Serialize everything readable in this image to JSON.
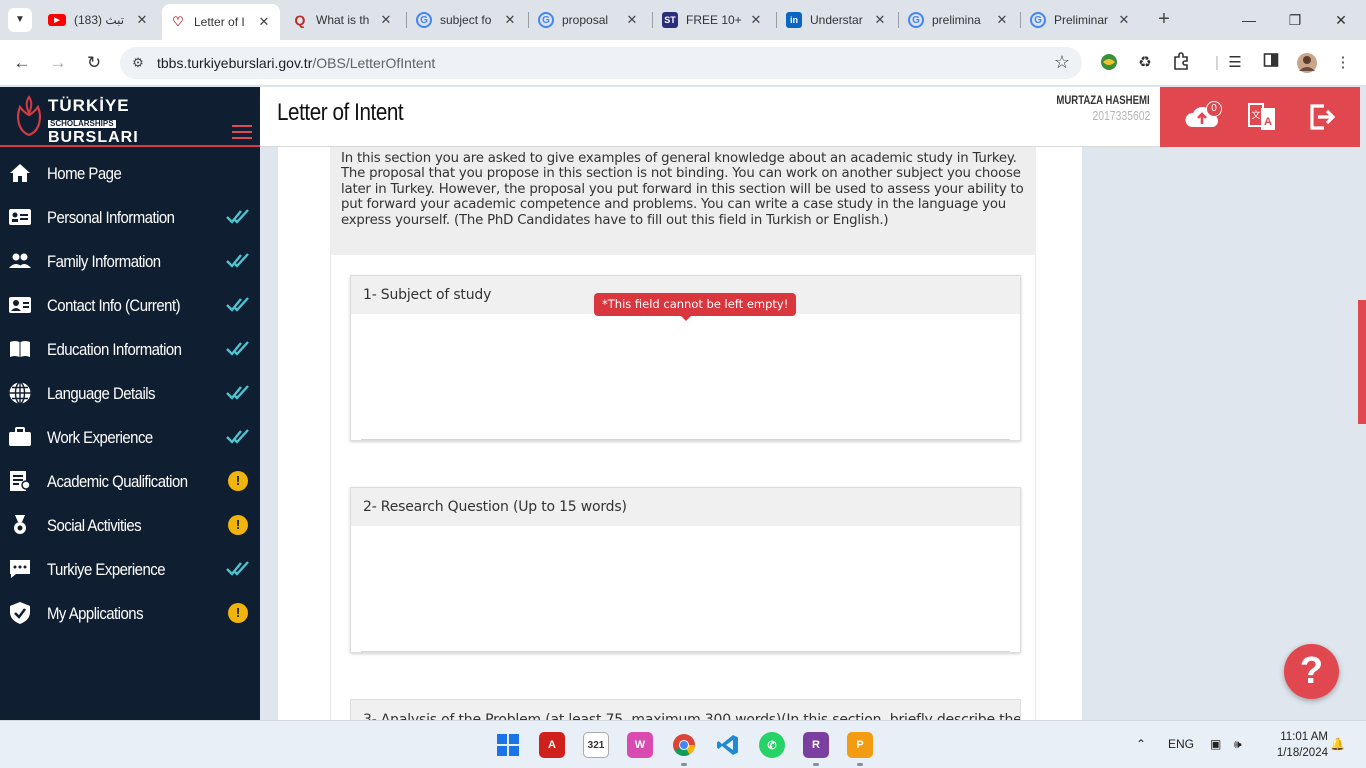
{
  "browser": {
    "tabs": [
      {
        "label": "(183) تبث",
        "favicon": "youtube-icon",
        "color": "#ff0000"
      },
      {
        "label": "Letter of I",
        "favicon": "turkiye-burslari-icon",
        "color": "#d43b43",
        "active": true
      },
      {
        "label": "What is th",
        "favicon": "quora-icon",
        "color": "#b92b27"
      },
      {
        "label": "subject fo",
        "favicon": "google-icon",
        "color": "#4285f4"
      },
      {
        "label": "proposal",
        "favicon": "google-icon",
        "color": "#4285f4"
      },
      {
        "label": "FREE 10+",
        "favicon": "scribd-icon",
        "color": "#2b2f7b",
        "favtext": "ST"
      },
      {
        "label": "Understar",
        "favicon": "linkedin-icon",
        "color": "#0a66c2",
        "favtext": "in"
      },
      {
        "label": "prelimina",
        "favicon": "google-icon",
        "color": "#4285f4"
      },
      {
        "label": "Preliminar",
        "favicon": "google-icon",
        "color": "#4285f4"
      }
    ],
    "url_host": "tbbs.turkiyeburslari.gov.tr",
    "url_path": "/OBS/LetterOfIntent"
  },
  "sidebar": {
    "logo": {
      "line1": "TÜRKİYE",
      "line2": "SCHOLARSHIPS",
      "line3": "BURSLARI"
    },
    "items": [
      {
        "label": "Home Page",
        "icon": "home-icon",
        "status": "none"
      },
      {
        "label": "Personal Information",
        "icon": "id-card-icon",
        "status": "done"
      },
      {
        "label": "Family Information",
        "icon": "users-icon",
        "status": "done"
      },
      {
        "label": "Contact Info (Current)",
        "icon": "contact-card-icon",
        "status": "done"
      },
      {
        "label": "Education Information",
        "icon": "book-icon",
        "status": "done"
      },
      {
        "label": "Language Details",
        "icon": "globe-icon",
        "status": "done"
      },
      {
        "label": "Work Experience",
        "icon": "briefcase-icon",
        "status": "done"
      },
      {
        "label": "Academic Qualification",
        "icon": "certificate-icon",
        "status": "warn"
      },
      {
        "label": "Social Activities",
        "icon": "award-icon",
        "status": "warn"
      },
      {
        "label": "Turkiye Experience",
        "icon": "chat-icon",
        "status": "done"
      },
      {
        "label": "My Applications",
        "icon": "shield-check-icon",
        "status": "warn"
      }
    ],
    "warn_symbol": "!"
  },
  "header": {
    "title": "Letter of Intent",
    "user_name": "MURTAZA HASHEMI",
    "user_id": "2017335602",
    "upload_count": "0"
  },
  "main": {
    "intro": "In this section you are asked to give examples of general knowledge about an academic study in Turkey. The proposal that you propose in this section is not binding. You can work on another subject you choose later in Turkey. However, the proposal you put forward in this section will be used to assess your ability to put forward your academic competence and problems. You can write a case study in the language you express yourself. (The PhD Candidates have to fill out this field in Turkish or English.)",
    "panels": [
      {
        "label": "1- Subject of study",
        "value": ""
      },
      {
        "label": "2- Research Question (Up to 15 words)",
        "value": ""
      }
    ],
    "panel3_label": "3- Analysis of the Problem (at least 75 ,maximum 300 words)(In this section, briefly describe the",
    "error_text": "*This field cannot be left empty!",
    "help_symbol": "?"
  },
  "taskbar": {
    "apps": [
      "windows-start",
      "acrobat",
      "calendar",
      "wampserver",
      "chrome",
      "vscode",
      "whatsapp",
      "winrar",
      "pdf-converter"
    ],
    "language": "ENG",
    "time": "11:01 AM",
    "date": "1/18/2024"
  },
  "colors": {
    "accent": "#e1474f",
    "sidebar_bg": "#0f1f31",
    "check": "#4fc3d0",
    "warn": "#f1b40b"
  }
}
